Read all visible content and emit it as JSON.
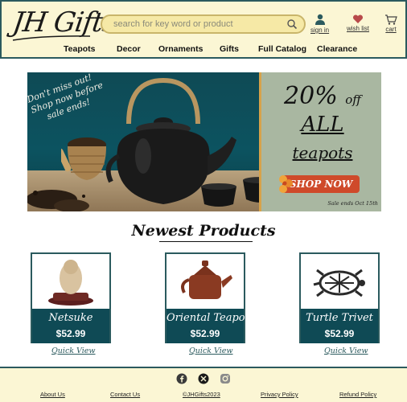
{
  "header": {
    "logo_text": "JH Gifts",
    "search_placeholder": "search for key word or product",
    "sign_in_label": "sign in",
    "wish_list_label": "wish list",
    "cart_label": "cart"
  },
  "nav": {
    "items": [
      "Teapots",
      "Decor",
      "Ornaments",
      "Gifts",
      "Full Catalog",
      "Clearance"
    ]
  },
  "banner": {
    "left_text_line1": "Don't miss out!",
    "left_text_line2": "Shop now before",
    "left_text_line3": "sale ends!",
    "promo_percent": "20%",
    "promo_off": "off",
    "promo_all": "ALL",
    "promo_teapots": "teapots",
    "shop_now_label": "SHOP NOW",
    "sale_ends": "Sale ends Oct 15th"
  },
  "section": {
    "title": "Newest Products"
  },
  "products": [
    {
      "name": "Netsuke",
      "price": "$52.99",
      "quick_view": "Quick View"
    },
    {
      "name": "Oriental Teapot",
      "price": "$52.99",
      "quick_view": "Quick View"
    },
    {
      "name": "Turtle Trivet",
      "price": "$52.99",
      "quick_view": "Quick View"
    }
  ],
  "footer": {
    "social_icons": [
      "facebook-icon",
      "x-icon",
      "instagram-icon"
    ],
    "links": [
      "About Us",
      "Contact Us",
      "©JHGifts2023",
      "Privacy Policy",
      "Refund Policy"
    ]
  },
  "colors": {
    "header_bg": "#fbf6d4",
    "accent_teal": "#0f4a55",
    "search_bg": "#f6e9a6",
    "shop_button": "#cf4a2a"
  }
}
